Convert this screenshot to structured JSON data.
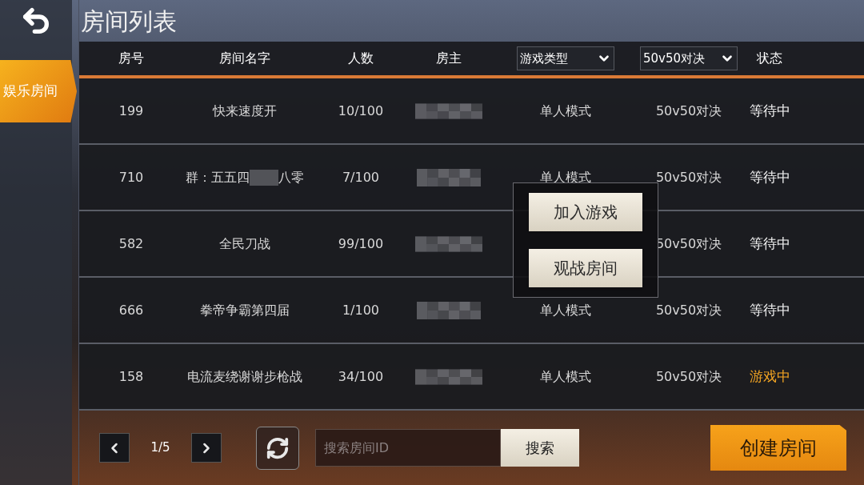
{
  "sidebar": {
    "tabs": [
      {
        "label": "娱乐房间",
        "selected": true
      }
    ]
  },
  "title": "房间列表",
  "table": {
    "columns": [
      {
        "kind": "text",
        "label": "房号"
      },
      {
        "kind": "text",
        "label": "房间名字"
      },
      {
        "kind": "text",
        "label": "人数"
      },
      {
        "kind": "text",
        "label": "房主"
      },
      {
        "kind": "dropdown",
        "label": "游戏类型"
      },
      {
        "kind": "dropdown",
        "label": "50v50对决"
      },
      {
        "kind": "text",
        "label": "状态"
      }
    ],
    "rows": [
      {
        "id": "199",
        "name": [
          "快来速度开"
        ],
        "players": "10/100",
        "mode": "单人模式",
        "match": "50v50对决",
        "status": "等待中",
        "color": "#f2f2f2"
      },
      {
        "id": "710",
        "name": [
          "群：五五四",
          "八零"
        ],
        "players": "7/100",
        "mode": "单人模式",
        "match": "50v50对决",
        "status": "等待中",
        "color": "#f2f2f2"
      },
      {
        "id": "582",
        "name": [
          "全民刀战"
        ],
        "players": "99/100",
        "match": "50v50对决",
        "status": "等待中",
        "color": "#f2f2f2"
      },
      {
        "id": "666",
        "name": [
          "拳帝争霸第四届"
        ],
        "players": "1/100",
        "mode": "单人模式",
        "match": "50v50对决",
        "status": "等待中",
        "color": "#f2f2f2"
      },
      {
        "id": "158",
        "name": [
          "电流麦绕谢谢步枪战"
        ],
        "players": "34/100",
        "mode": "单人模式",
        "match": "50v50对决",
        "status": "游戏中",
        "color": "#f5a623"
      }
    ]
  },
  "popup": {
    "buttons": [
      "加入游戏",
      "观战房间"
    ]
  },
  "pager": {
    "page": "1/5"
  },
  "search": {
    "placeholder": "搜索房间ID",
    "button": "搜索"
  },
  "create_button": "创建房间"
}
